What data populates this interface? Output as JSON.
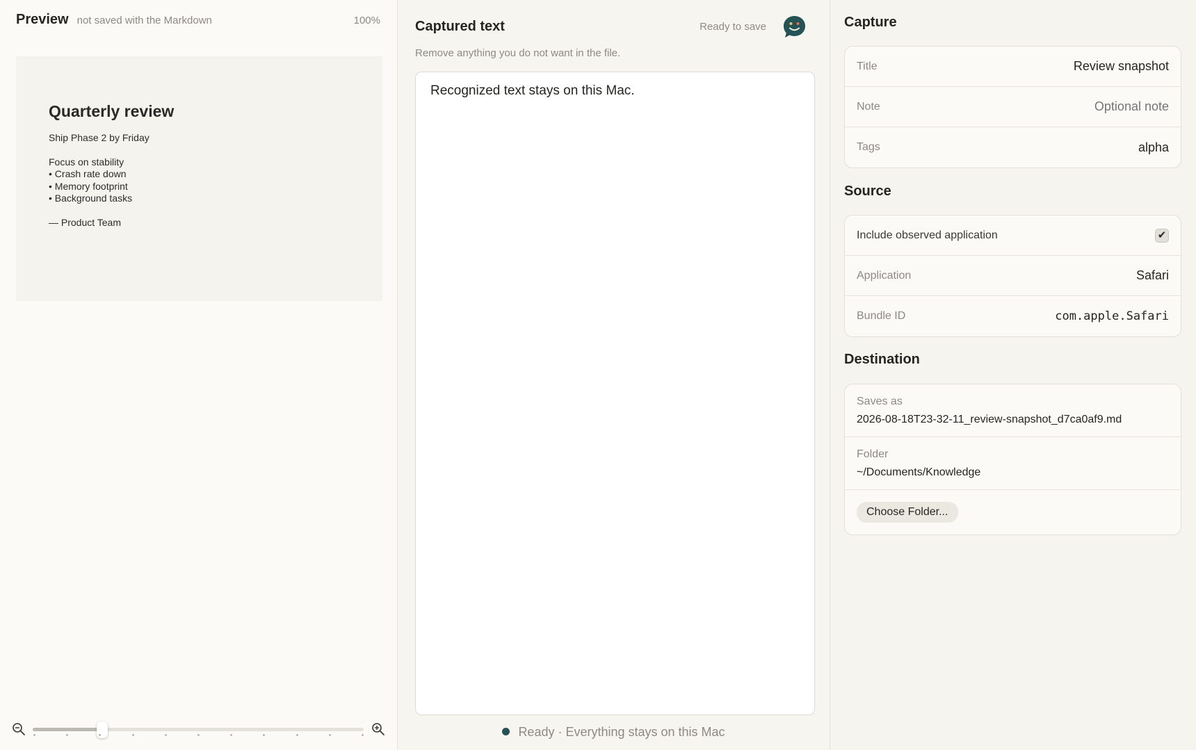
{
  "preview": {
    "title": "Preview",
    "subtitle": "not saved with the Markdown",
    "zoom_percent": "100%",
    "document": {
      "heading": "Quarterly review",
      "line_1": "Ship Phase 2 by Friday",
      "line_2": "Focus on stability",
      "bullet_1": "• Crash rate down",
      "bullet_2": "• Memory footprint",
      "bullet_3": "• Background tasks",
      "signature": "— Product Team"
    },
    "zoom_slider": {
      "value_fraction": 0.21,
      "tick_count": 11
    }
  },
  "captured": {
    "title": "Captured text",
    "status": "Ready to save",
    "hint": "Remove anything you do not want in the file.",
    "text": "Recognized text stays on this Mac.",
    "footer": "Ready · Everything stays on this Mac",
    "accent_color": "#245255"
  },
  "capture": {
    "heading": "Capture",
    "title_label": "Title",
    "title_value": "Review snapshot",
    "note_label": "Note",
    "note_value": "Optional note",
    "tags_label": "Tags",
    "tags_value": "alpha"
  },
  "source": {
    "heading": "Source",
    "include_label": "Include observed application",
    "include_checked": true,
    "application_label": "Application",
    "application_value": "Safari",
    "bundle_label": "Bundle ID",
    "bundle_value": "com.apple.Safari"
  },
  "destination": {
    "heading": "Destination",
    "saves_as_label": "Saves as",
    "saves_as_value": "2026-08-18T23-32-11_review-snapshot_d7ca0af9.md",
    "folder_label": "Folder",
    "folder_value": "~/Documents/Knowledge",
    "choose_button": "Choose Folder..."
  }
}
